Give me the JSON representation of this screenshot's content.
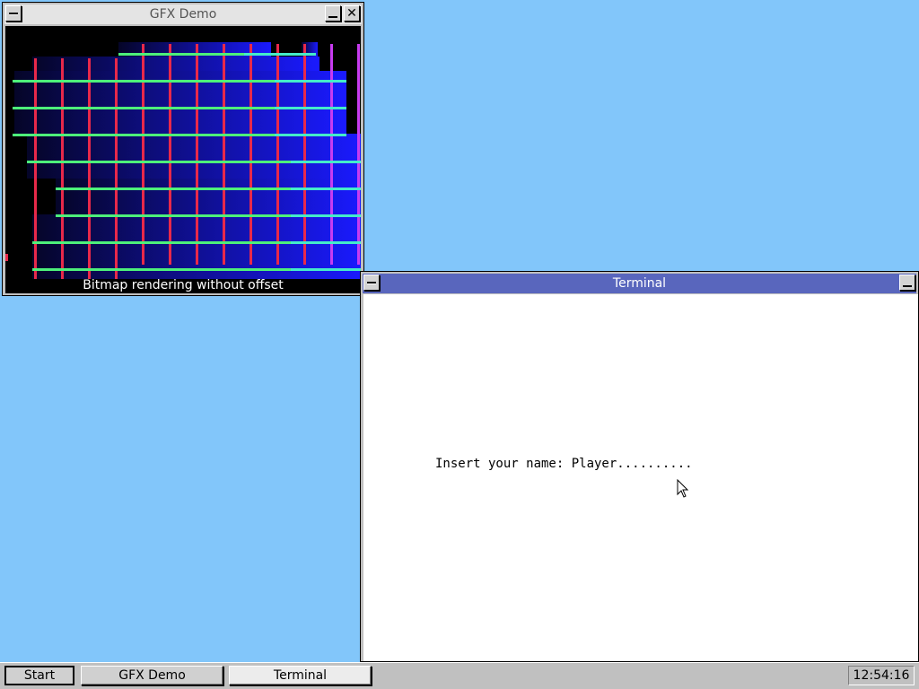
{
  "windows": {
    "gfx": {
      "title": "GFX Demo",
      "caption": "Bitmap rendering without offset",
      "colors": {
        "background": "#000000",
        "gradient_start": "#050528",
        "gradient_end": "#1a1aff",
        "vertical_lines": "#e8294a",
        "vertical_lines_right": "#c83cf0",
        "horizontal_lines": "#4df07a",
        "horizontal_lines_right": "#40e8ff"
      }
    },
    "terminal": {
      "title": "Terminal",
      "prompt_line": "Insert your name: Player.........."
    }
  },
  "taskbar": {
    "start_label": "Start",
    "tasks": [
      "GFX Demo",
      "Terminal"
    ],
    "clock": "12:54:16"
  },
  "colors": {
    "desktop": "#82c6fa",
    "active_titlebar": "#5966bd",
    "inactive_titlebar": "#e4e4e4"
  }
}
